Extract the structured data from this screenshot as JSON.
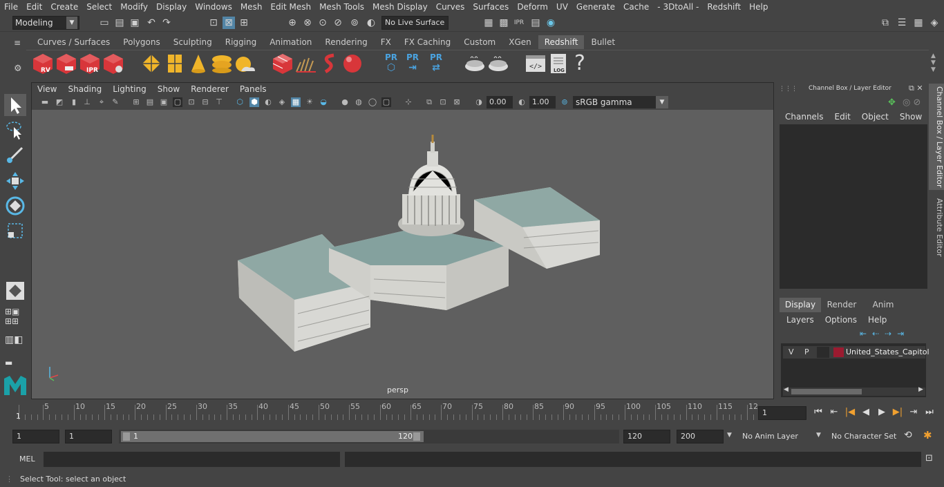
{
  "menubar": [
    "File",
    "Edit",
    "Create",
    "Select",
    "Modify",
    "Display",
    "Windows",
    "Mesh",
    "Edit Mesh",
    "Mesh Tools",
    "Mesh Display",
    "Curves",
    "Surfaces",
    "Deform",
    "UV",
    "Generate",
    "Cache",
    "- 3DtoAll -",
    "Redshift",
    "Help"
  ],
  "status": {
    "mode": "Modeling",
    "live_surface": "No Live Surface"
  },
  "shelf_tabs": [
    "Curves / Surfaces",
    "Polygons",
    "Sculpting",
    "Rigging",
    "Animation",
    "Rendering",
    "FX",
    "FX Caching",
    "Custom",
    "XGen",
    "Redshift",
    "Bullet"
  ],
  "shelf_active": "Redshift",
  "shelf_icons": {
    "rv": "RV",
    "ipr": "IPR",
    "pr1": "PR",
    "pr2": "PR",
    "pr3": "PR",
    "log": "LOG",
    "help": "?"
  },
  "viewport": {
    "menu": [
      "View",
      "Shading",
      "Lighting",
      "Show",
      "Renderer",
      "Panels"
    ],
    "exposure": "0.00",
    "gamma_value": "1.00",
    "color_space": "sRGB gamma",
    "camera": "persp"
  },
  "channel_box": {
    "title": "Channel Box / Layer Editor",
    "menu": [
      "Channels",
      "Edit",
      "Object",
      "Show"
    ]
  },
  "layer_editor": {
    "tabs": [
      "Display",
      "Render",
      "Anim"
    ],
    "active_tab": "Display",
    "menu": [
      "Layers",
      "Options",
      "Help"
    ],
    "layers": [
      {
        "v": "V",
        "p": "P",
        "name": "United_States_Capitol",
        "color": "#9b1b30"
      }
    ]
  },
  "side_tabs": [
    "Channel Box / Layer Editor",
    "Attribute Editor"
  ],
  "timeline": {
    "ticks": [
      "5",
      "10",
      "15",
      "20",
      "25",
      "30",
      "35",
      "40",
      "45",
      "50",
      "55",
      "60",
      "65",
      "70",
      "75",
      "80",
      "85",
      "90",
      "95",
      "100",
      "105",
      "110",
      "115",
      "12"
    ],
    "start_marker": "1",
    "current_frame": "1"
  },
  "range": {
    "start": "1",
    "playback_start": "1",
    "slider_start": "1",
    "slider_end": "120",
    "playback_end": "120",
    "end": "200",
    "anim_layer": "No Anim Layer",
    "character_set": "No Character Set"
  },
  "command": {
    "label": "MEL"
  },
  "statusbar": {
    "text": "Select Tool: select an object"
  },
  "colors": {
    "accent_red": "#d8363a",
    "pr_blue": "#4aa3e0",
    "yellow": "#f0b52a"
  }
}
